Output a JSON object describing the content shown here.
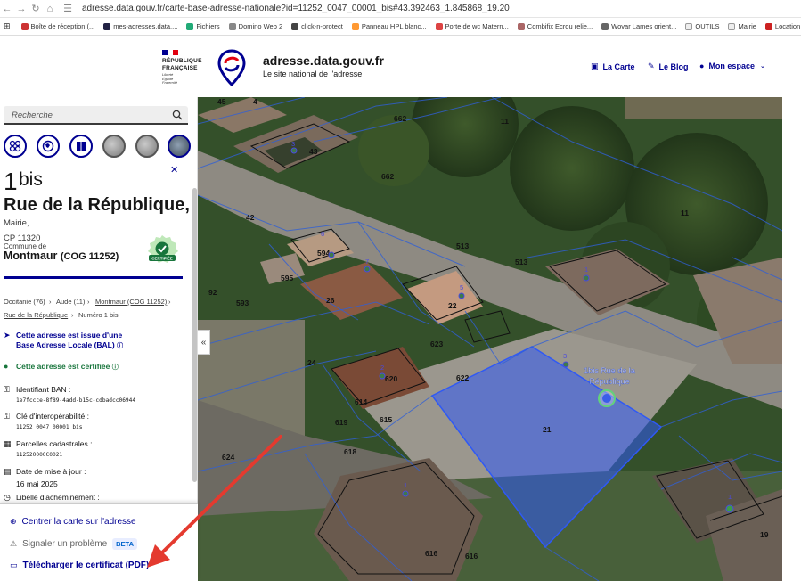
{
  "browser": {
    "url": "adresse.data.gouv.fr/carte-base-adresse-nationale?id=11252_0047_00001_bis#43.392463_1.845868_19.20",
    "bookmarks": [
      "Boîte de réception (...",
      "mes-adresses.data....",
      "Fichiers",
      "Domino Web 2",
      "click-n-protect",
      "Panneau HPL blanc...",
      "Porte de wc Matern...",
      "Combifix Ecrou relie...",
      "Wovar Lames orient...",
      "OUTILS",
      "Mairie",
      "Location salle p"
    ]
  },
  "header": {
    "gov_lines": [
      "RÉPUBLIQUE",
      "FRANÇAISE"
    ],
    "devise": [
      "Liberté",
      "Égalité",
      "Fraternité"
    ],
    "site_title": "adresse.data.gouv.fr",
    "site_subtitle": "Le site national de l'adresse",
    "nav": [
      {
        "label": "La Carte",
        "icon": "map-icon"
      },
      {
        "label": "Le Blog",
        "icon": "pen-icon"
      },
      {
        "label": "Mon espace",
        "icon": "user-icon"
      }
    ]
  },
  "search": {
    "placeholder": "Recherche"
  },
  "address": {
    "number": "1",
    "suffix": "bis",
    "street": "Rue de la République,",
    "lieu": "Mairie,",
    "postcode": "CP 11320",
    "commune_label": "Commune de",
    "commune": "Montmaur",
    "cog": "(COG 11252)",
    "badge": "CERTIFIÉE"
  },
  "breadcrumb": {
    "items": [
      "Occitanie (76)",
      "Aude (11)",
      "Montmaur (COG 11252)",
      "Rue de la République",
      "Numéro 1 bis"
    ]
  },
  "info": {
    "bal_text": [
      "Cette adresse est issue d'une",
      "Base Adresse Locale (BAL)"
    ],
    "certified_text": "Cette adresse est certifiée",
    "ban_id_label": "Identifiant BAN :",
    "ban_id": "1e7fccce-8f89-4add-b15c-cdbadcc06944",
    "interop_label": "Clé d'interopérabilité :",
    "interop": "11252_0047_00001_bis",
    "parcels_label": "Parcelles cadastrales :",
    "parcels": "112520000C0021",
    "update_label": "Date de mise à jour :",
    "update": "16 mai 2025",
    "delivery_label": "Libellé d'acheminement :"
  },
  "actions": {
    "center": "Centrer la carte sur l'adresse",
    "report": "Signaler un problème",
    "beta": "BETA",
    "download": "Télécharger le certificat (PDF)"
  },
  "map": {
    "selected_label": [
      "1bis Rue de la",
      "République"
    ],
    "parcels": [
      "45",
      "4",
      "662",
      "11",
      "43",
      "662",
      "42",
      "11",
      "513",
      "594",
      "513",
      "595",
      "92",
      "593",
      "26",
      "22",
      "623",
      "24",
      "620",
      "622",
      "614",
      "615",
      "619",
      "21",
      "618",
      "624",
      "616",
      "616",
      "19"
    ],
    "house_numbers": [
      "6",
      "3",
      "2",
      "1",
      "7",
      "5",
      "1",
      "2",
      "3",
      "1",
      "1"
    ]
  },
  "colors": {
    "accent": "#000091",
    "success": "#18753c",
    "highlight": "#2f59f5"
  }
}
